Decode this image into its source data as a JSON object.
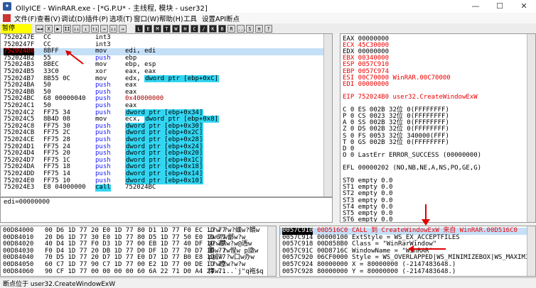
{
  "window": {
    "title": "OllyICE - WinRAR.exe - [*G.P.U* - 主线程, 模块 - user32]",
    "controls": [
      "—",
      "☐",
      "✕"
    ]
  },
  "menu": [
    "文件(F)",
    "查看(V)",
    "调试(D)",
    "插件(P)",
    "选项(T)",
    "窗口(W)",
    "帮助(H)",
    "工具",
    "设置API断点"
  ],
  "toolbar": {
    "status": "暂停",
    "buttons": [
      "◄◄",
      "X",
      "▶",
      "II",
      "↓↓",
      "↓",
      "↑↓",
      "→",
      "↓↓",
      "→",
      "L",
      "E",
      "M",
      "T",
      "W",
      "H",
      "C",
      "/",
      "K",
      "B",
      "R",
      "...",
      "S",
      "≡",
      "?"
    ]
  },
  "disasm": {
    "rows": [
      {
        "addr": "7520247E",
        "hex": "CC",
        "mn": "int3",
        "op": "",
        "kind": "plain"
      },
      {
        "addr": "7520247F",
        "hex": "CC",
        "mn": "int3",
        "op": "",
        "kind": "plain"
      },
      {
        "addr": "752024B0",
        "hex": "8BFF",
        "mn": "mov",
        "op": "edi, edi",
        "kind": "selected"
      },
      {
        "addr": "752024B2",
        "hex": "55",
        "mn": "push",
        "op": "ebp",
        "kind": "push"
      },
      {
        "addr": "752024B3",
        "hex": "8BEC",
        "mn": "mov",
        "op": "ebp, esp",
        "kind": "plain"
      },
      {
        "addr": "752024B5",
        "hex": "33C0",
        "mn": "xor",
        "op": "eax, eax",
        "kind": "plain"
      },
      {
        "addr": "752024B7",
        "hex": "8B55 0C",
        "mn": "mov",
        "op": "edx, ",
        "opmem": "dword ptr [ebp+0xC]",
        "kind": "plain"
      },
      {
        "addr": "752024BA",
        "hex": "50",
        "mn": "push",
        "op": "eax",
        "kind": "push"
      },
      {
        "addr": "752024BB",
        "hex": "50",
        "mn": "push",
        "op": "eax",
        "kind": "push"
      },
      {
        "addr": "752024BC",
        "hex": "68 00000040",
        "mn": "push",
        "opnum": "0x40000000",
        "kind": "push"
      },
      {
        "addr": "752024C1",
        "hex": "50",
        "mn": "push",
        "op": "eax",
        "kind": "push"
      },
      {
        "addr": "752024C2",
        "hex": "FF75 34",
        "mn": "push",
        "opmem": "dword ptr [ebp+0x34]",
        "kind": "push"
      },
      {
        "addr": "752024C5",
        "hex": "8B4D 08",
        "mn": "mov",
        "op": "ecx, ",
        "opmem": "dword ptr [ebp+0x8]",
        "kind": "plain"
      },
      {
        "addr": "752024C8",
        "hex": "FF75 30",
        "mn": "push",
        "opmem": "dword ptr [ebp+0x30]",
        "kind": "push"
      },
      {
        "addr": "752024CB",
        "hex": "FF75 2C",
        "mn": "push",
        "opmem": "dword ptr [ebp+0x2C]",
        "kind": "push"
      },
      {
        "addr": "752024CE",
        "hex": "FF75 28",
        "mn": "push",
        "opmem": "dword ptr [ebp+0x28]",
        "kind": "push"
      },
      {
        "addr": "752024D1",
        "hex": "FF75 24",
        "mn": "push",
        "opmem": "dword ptr [ebp+0x24]",
        "kind": "push"
      },
      {
        "addr": "752024D4",
        "hex": "FF75 20",
        "mn": "push",
        "opmem": "dword ptr [ebp+0x20]",
        "kind": "push"
      },
      {
        "addr": "752024D7",
        "hex": "FF75 1C",
        "mn": "push",
        "opmem": "dword ptr [ebp+0x1C]",
        "kind": "push"
      },
      {
        "addr": "752024DA",
        "hex": "FF75 18",
        "mn": "push",
        "opmem": "dword ptr [ebp+0x18]",
        "kind": "push"
      },
      {
        "addr": "752024DD",
        "hex": "FF75 14",
        "mn": "push",
        "opmem": "dword ptr [ebp+0x14]",
        "kind": "push"
      },
      {
        "addr": "752024E0",
        "hex": "FF75 10",
        "mn": "push",
        "opmem": "dword ptr [ebp+0x10]",
        "kind": "push"
      },
      {
        "addr": "752024E3",
        "hex": "E8 04000000",
        "mn": "call",
        "op": "752024BC",
        "kind": "call"
      }
    ]
  },
  "info_line": "edi=00000000",
  "registers": {
    "rows": [
      {
        "t": "EAX 00000000",
        "red": false
      },
      {
        "t": "ECX 45C30000",
        "red": true
      },
      {
        "t": "EDX 00000000",
        "red": false
      },
      {
        "t": "EBX 00340000",
        "red": true
      },
      {
        "t": "ESP 0057C910",
        "red": true
      },
      {
        "t": "EBP 0057C974",
        "red": true
      },
      {
        "t": "ESI 00C70000 WinRAR.00C70000",
        "red": true
      },
      {
        "t": "EDI 00000000",
        "red": true
      },
      {
        "t": "",
        "red": false
      },
      {
        "t": "EIP 752024B0 user32.CreateWindowExW",
        "red": true
      },
      {
        "t": "",
        "red": false
      },
      {
        "t": "C 0  ES 002B 32位 0(FFFFFFFF)",
        "red": false
      },
      {
        "t": "P 0  CS 0023 32位 0(FFFFFFFF)",
        "red": false
      },
      {
        "t": "A 0  SS 002B 32位 0(FFFFFFFF)",
        "red": false
      },
      {
        "t": "Z 0  DS 002B 32位 0(FFFFFFFF)",
        "red": false
      },
      {
        "t": "S 0  FS 0053 32位 340000(FFF)",
        "red": false
      },
      {
        "t": "T 0  GS 002B 32位 0(FFFFFFFF)",
        "red": false
      },
      {
        "t": "D 0",
        "red": false
      },
      {
        "t": "O 0  LastErr ERROR_SUCCESS (00000000)",
        "red": false
      },
      {
        "t": "",
        "red": false
      },
      {
        "t": "EFL 00000202 (NO,NB,NE,A,NS,PO,GE,G)",
        "red": false
      },
      {
        "t": "",
        "red": false
      },
      {
        "t": "ST0 empty 0.0",
        "red": false
      },
      {
        "t": "ST1 empty 0.0",
        "red": false
      },
      {
        "t": "ST2 empty 0.0",
        "red": false
      },
      {
        "t": "ST3 empty 0.0",
        "red": false
      },
      {
        "t": "ST4 empty 0.0",
        "red": false
      },
      {
        "t": "ST5 empty 0.0",
        "red": false
      },
      {
        "t": "ST6 empty 0.0",
        "red": false
      }
    ]
  },
  "dump": {
    "rows": [
      {
        "addr": "00D84000",
        "hex": "00 D6 1D 77 20 E0 1D 77 80 D1 1D 77 F0 EC 1D 77",
        "asc": ".?w ?w?蜖w?鳂w"
      },
      {
        "addr": "00D84010",
        "hex": "20 D6 1D 77 30 E0 1D 77 80 D5 1D 77 50 E0 1D 77",
        "asc": "?w0?w鄶w?w"
      },
      {
        "addr": "00D84020",
        "hex": "40 D4 1D 77 F0 D3 1D 77 00 EB 1D 77 40 DF 1D 77",
        "asc": "@?w鹏w?w@遤w"
      },
      {
        "addr": "00D84030",
        "hex": "F0 D4 1D 77 20 DB 1D 77 D0 DF 1D 77 70 D7 1D 77",
        "asc": "鹏w ?w惺w p譈w"
      },
      {
        "addr": "00D84040",
        "hex": "70 D5 1D 77 20 D7 1D 77 E0 D7 1D 77 B0 E8 1D 77",
        "asc": "p誠w ?w囗w办w"
      },
      {
        "addr": "00D84050",
        "hex": "60 C7 1D 77 90 C7 1D 77 00 E2 1D 77 00 DE 1D 77",
        "asc": "`?w悆w?w?w"
      },
      {
        "addr": "00D84060",
        "hex": "90 CF 1D 77 00 00 00 00 60 6A 22 71 D0 A4 24 71",
        "asc": "惸w....`j\"q袘$q"
      }
    ]
  },
  "stack": {
    "rows": [
      {
        "addr": "0057C910",
        "val": "00D516C0",
        "com": "CALL 到 CreateWindowExW 来自 WinRAR.00D516C0",
        "kind": "selected"
      },
      {
        "addr": "0057C914",
        "val": "00000100",
        "com": "ExtStyle = WS_EX_ACCEPTFILES",
        "kind": "plain"
      },
      {
        "addr": "0057C918",
        "val": "00D858B0",
        "com": "Class = \"WinRarWindow\"",
        "kind": "plain"
      },
      {
        "addr": "0057C91C",
        "val": "00D8716C",
        "com": "WindowName = \"WinRAR\"",
        "kind": "plain"
      },
      {
        "addr": "0057C920",
        "val": "06CF0000",
        "com": "Style = WS_OVERLAPPED|WS_MINIMIZEBOX|WS_MAXIMIZEBO",
        "kind": "plain"
      },
      {
        "addr": "0057C924",
        "val": "80000000",
        "com": "X = 80000000 (-2147483648.)",
        "kind": "plain"
      },
      {
        "addr": "0057C928",
        "val": "80000000",
        "com": "Y = 80000000 (-2147483648.)",
        "kind": "plain"
      }
    ]
  },
  "statusbar": "断点位于 user32.CreateWindowExW",
  "colors": {
    "accent_red": "#e00000",
    "highlight_cyan": "#33d6f2",
    "pause_yellow": "#ffff00"
  }
}
